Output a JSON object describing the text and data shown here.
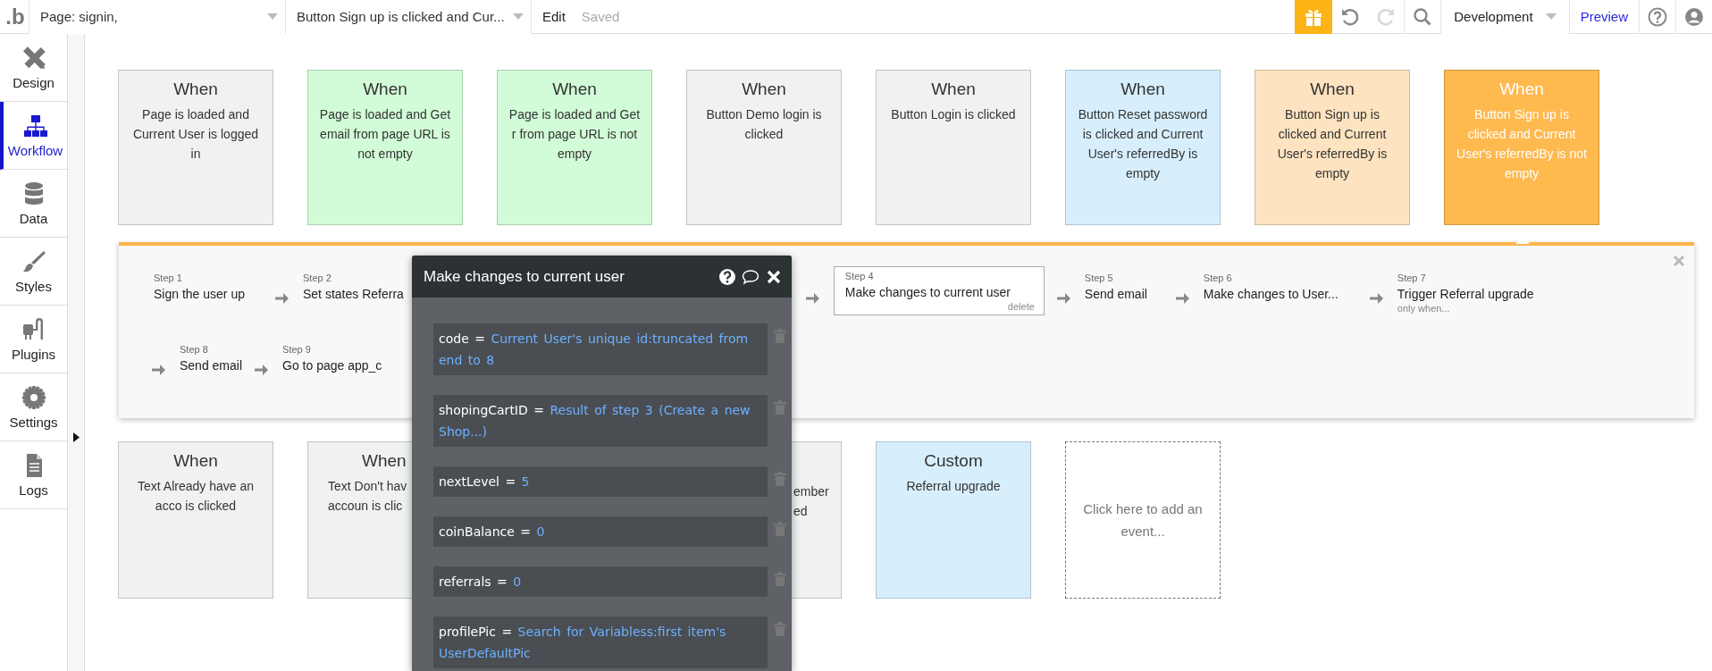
{
  "top_bar": {
    "logo": ".b",
    "page_selector": "Page: signin,",
    "event_selector": "Button Sign up is clicked and Cur...",
    "edit": "Edit",
    "save_status": "Saved",
    "undo": {
      "disabled": false
    },
    "redo": {
      "disabled": true
    },
    "environment": "Development",
    "preview": "Preview"
  },
  "sidebar": {
    "items": [
      {
        "kind": "design",
        "label": "Design",
        "selected": false
      },
      {
        "kind": "workflow",
        "label": "Workflow",
        "selected": true
      },
      {
        "kind": "data",
        "label": "Data",
        "selected": false
      },
      {
        "kind": "styles",
        "label": "Styles",
        "selected": false
      },
      {
        "kind": "plugins",
        "label": "Plugins",
        "selected": false
      },
      {
        "kind": "settings",
        "label": "Settings",
        "selected": false
      },
      {
        "kind": "logs",
        "label": "Logs",
        "selected": false
      }
    ]
  },
  "events_top": [
    {
      "title": "When",
      "text": "Page is loaded and Current User is logged in",
      "color": "#f0f1f1",
      "selected": false
    },
    {
      "title": "When",
      "text": "Page is loaded and Get email from page URL is not empty",
      "color": "#d1fcd7",
      "selected": false
    },
    {
      "title": "When",
      "text": "Page is loaded and Get r from page URL is not empty",
      "color": "#d1fcd7",
      "selected": false
    },
    {
      "title": "When",
      "text": "Button Demo login is clicked",
      "color": "#f0f1f1",
      "selected": false
    },
    {
      "title": "When",
      "text": "Button Login is clicked",
      "color": "#f0f1f1",
      "selected": false
    },
    {
      "title": "When",
      "text": "Button Reset password is clicked and Current User's referredBy is empty",
      "color": "#d7effd",
      "selected": false
    },
    {
      "title": "When",
      "text": "Button Sign up is clicked and Current User's referredBy is empty",
      "color": "#fde3bf",
      "selected": false
    },
    {
      "title": "When",
      "text": "Button Sign up is clicked and Current User's referredBy is not empty",
      "color": "#feb94f",
      "selected": true
    }
  ],
  "workflow": {
    "rows": [
      [
        {
          "label": "Step 1",
          "action": "Sign the user up",
          "selected": false
        },
        {
          "label": "Step 2",
          "action": "Set states Referra",
          "selected": false
        },
        {
          "label": "Step 4",
          "action": "Make changes to current user",
          "selected": true,
          "delete": "delete"
        },
        {
          "label": "Step 5",
          "action": "Send email",
          "selected": false
        },
        {
          "label": "Step 6",
          "action": "Make changes to User...",
          "selected": false
        },
        {
          "label": "Step 7",
          "action": "Trigger Referral upgrade",
          "selected": false,
          "condition": "only when..."
        }
      ],
      [
        {
          "label": "Step 8",
          "action": "Send email",
          "selected": false
        },
        {
          "label": "Step 9",
          "action": "Go to page app_c",
          "selected": false
        }
      ]
    ]
  },
  "popup": {
    "title": "Make changes to current user",
    "fields": [
      {
        "key": "code =",
        "value": "Current User's unique id:truncated from end to 8"
      },
      {
        "key": "shopingCartID =",
        "value": "Result of step 3 (Create a new Shop...)"
      },
      {
        "key": "nextLevel =",
        "value": "5"
      },
      {
        "key": "coinBalance =",
        "value": "0"
      },
      {
        "key": "referrals =",
        "value": "0"
      },
      {
        "key": "profilePic =",
        "value": "Search for Variabless:first item's UserDefaultPic"
      }
    ]
  },
  "events_bottom": [
    {
      "kind": "event",
      "title": "When",
      "text": "Text Already have an acco is clicked",
      "color": "#f0f1f1"
    },
    {
      "kind": "covered-right",
      "title": "When",
      "text": "Text Don't hav\naccoun is clic",
      "color": "#f0f1f1"
    },
    {
      "kind": "covered-left",
      "text": "ember\ned",
      "color": "#f0f1f1"
    },
    {
      "kind": "event",
      "title": "Custom",
      "text": "Referral upgrade",
      "color": "#d7effd"
    },
    {
      "kind": "add",
      "text": "Click here to add an event..."
    }
  ]
}
